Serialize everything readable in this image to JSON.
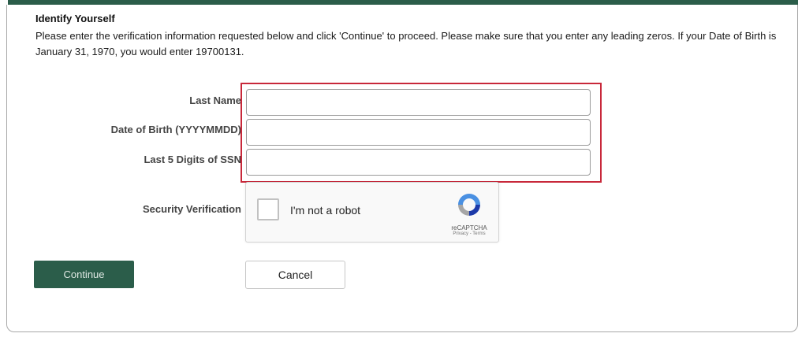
{
  "form": {
    "heading": "Identify Yourself",
    "instructions": "Please enter the verification information requested below and click 'Continue' to proceed. Please make sure that you enter any leading zeros. If your Date of Birth is January 31, 1970, you would enter 19700131.",
    "fields": [
      {
        "label": "Last Name",
        "value": ""
      },
      {
        "label": "Date of Birth (YYYYMMDD)",
        "value": ""
      },
      {
        "label": "Last 5 Digits of SSN",
        "value": ""
      }
    ],
    "security_label": "Security Verification"
  },
  "captcha": {
    "checkbox_label": "I'm not a robot",
    "brand": "reCAPTCHA",
    "links": "Privacy - Terms",
    "icon": "recaptcha-icon"
  },
  "buttons": {
    "continue_label": "Continue",
    "cancel_label": "Cancel"
  },
  "colors": {
    "primary": "#2b5d4a",
    "highlight": "#c8283a"
  }
}
